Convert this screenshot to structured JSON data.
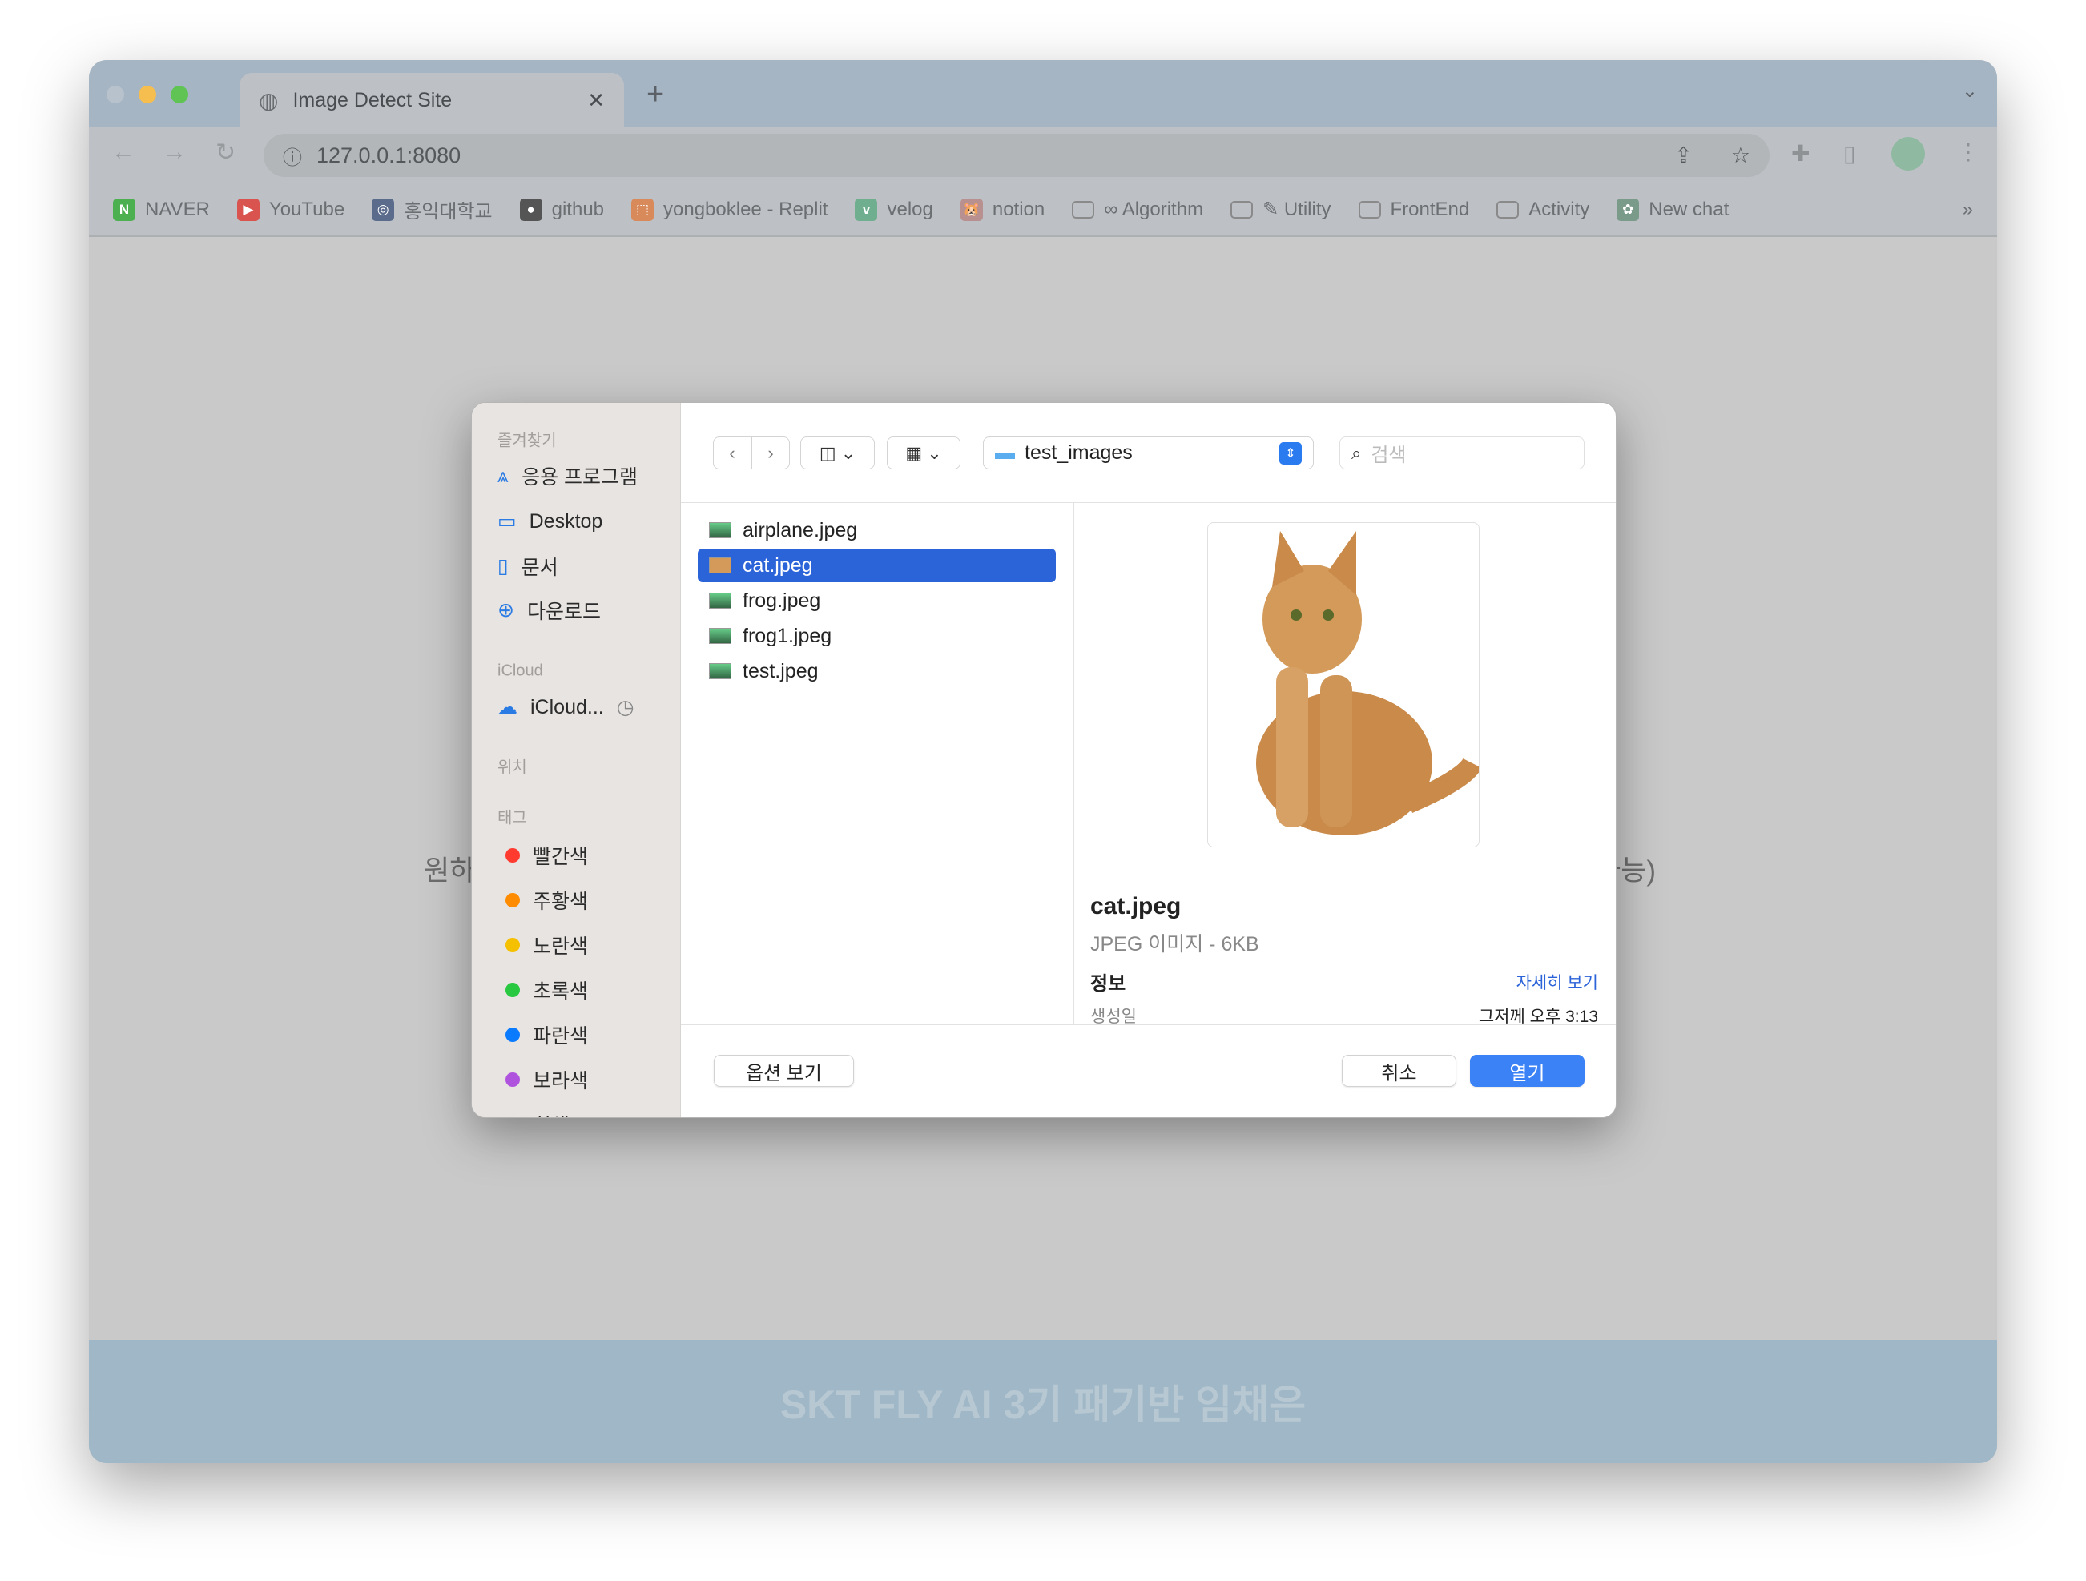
{
  "browser": {
    "tab_title": "Image Detect Site",
    "url": "127.0.0.1:8080",
    "bookmarks": [
      {
        "label": "NAVER",
        "icon": "naver-icon",
        "color": "#4caf50",
        "glyph": "N"
      },
      {
        "label": "YouTube",
        "icon": "youtube-icon",
        "color": "#d9534f",
        "glyph": "▶"
      },
      {
        "label": "홍익대학교",
        "icon": "university-icon",
        "color": "#5b6b8c",
        "glyph": "◎"
      },
      {
        "label": "github",
        "icon": "github-icon",
        "color": "#555555",
        "glyph": "●"
      },
      {
        "label": "yongboklee - Replit",
        "icon": "replit-icon",
        "color": "#d98a5a",
        "glyph": "⬚"
      },
      {
        "label": "velog",
        "icon": "velog-icon",
        "color": "#6fae8f",
        "glyph": "v"
      },
      {
        "label": "notion",
        "icon": "notion-icon",
        "color": "#b89090",
        "glyph": "🐹"
      },
      {
        "label": "∞ Algorithm",
        "icon": "folder-icon",
        "color": "#8a8a8a",
        "glyph": ""
      },
      {
        "label": "✎ Utility",
        "icon": "folder-icon",
        "color": "#8a8a8a",
        "glyph": ""
      },
      {
        "label": "FrontEnd",
        "icon": "folder-icon",
        "color": "#8a8a8a",
        "glyph": ""
      },
      {
        "label": "Activity",
        "icon": "folder-icon",
        "color": "#8a8a8a",
        "glyph": ""
      },
      {
        "label": "New chat",
        "icon": "chatgpt-icon",
        "color": "#7a9a8a",
        "glyph": "✿"
      }
    ],
    "more_bookmarks": "»"
  },
  "page": {
    "bg_text_left": "원하",
    "bg_text_right": "가능)",
    "footer": "SKT FLY AI 3기 패기반 임채은"
  },
  "dialog": {
    "sidebar": {
      "favorites_header": "즐겨찾기",
      "favorites": [
        {
          "label": "응용 프로그램",
          "icon": "applications-icon"
        },
        {
          "label": "Desktop",
          "icon": "desktop-icon"
        },
        {
          "label": "문서",
          "icon": "document-icon"
        },
        {
          "label": "다운로드",
          "icon": "download-icon"
        }
      ],
      "icloud_header": "iCloud",
      "icloud_item": "iCloud...",
      "locations_header": "위치",
      "tags_header": "태그",
      "tags": [
        {
          "label": "빨간색",
          "color": "#ff3b30"
        },
        {
          "label": "주황색",
          "color": "#ff8c00"
        },
        {
          "label": "노란색",
          "color": "#f5c000"
        },
        {
          "label": "초록색",
          "color": "#28c840"
        },
        {
          "label": "파란색",
          "color": "#0a7aff"
        },
        {
          "label": "보라색",
          "color": "#af52de"
        },
        {
          "label": "회색",
          "color": "#8e8e93"
        }
      ]
    },
    "toolbar": {
      "folder": "test_images",
      "search_placeholder": "검색"
    },
    "files": [
      {
        "name": "airplane.jpeg",
        "selected": false
      },
      {
        "name": "cat.jpeg",
        "selected": true
      },
      {
        "name": "frog.jpeg",
        "selected": false
      },
      {
        "name": "frog1.jpeg",
        "selected": false
      },
      {
        "name": "test.jpeg",
        "selected": false
      }
    ],
    "preview": {
      "name": "cat.jpeg",
      "kind": "JPEG 이미지 - 6KB",
      "info_label": "정보",
      "more_link": "자세히 보기",
      "created_label": "생성일",
      "created_value": "그저께 오후 3:13"
    },
    "buttons": {
      "options": "옵션 보기",
      "cancel": "취소",
      "open": "열기"
    },
    "accent": "#2b63d9"
  }
}
